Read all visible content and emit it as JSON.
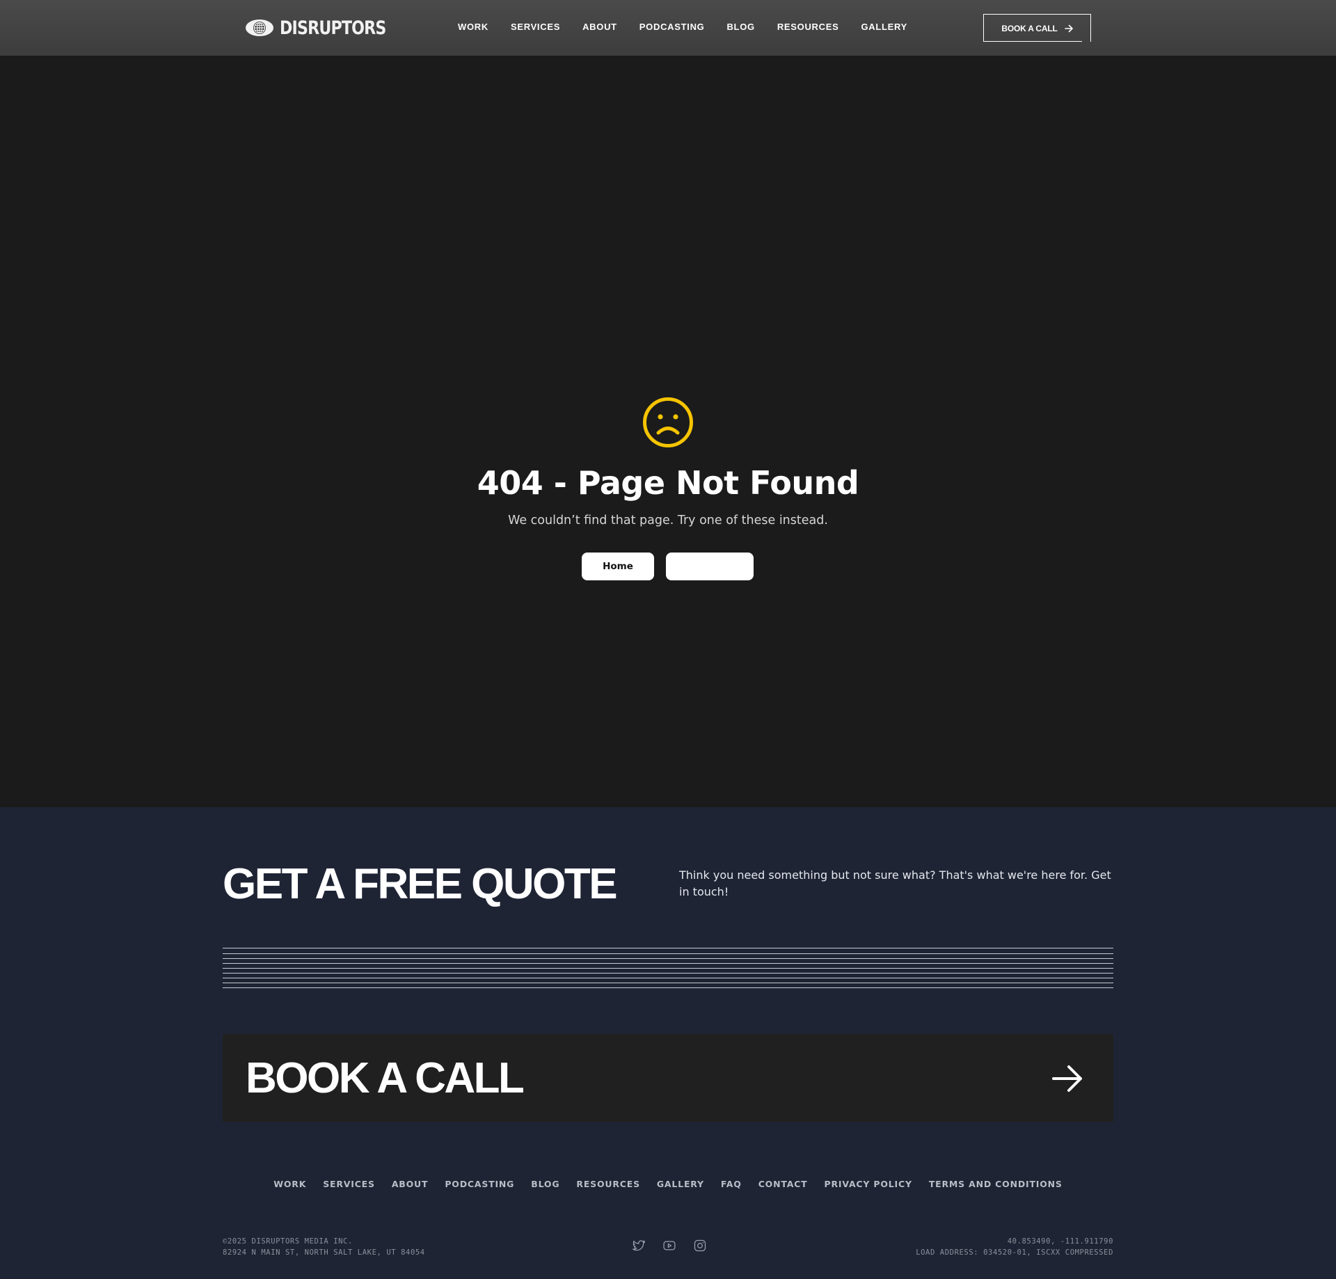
{
  "header": {
    "logo_text": "DISRUPTORS",
    "nav": [
      "WORK",
      "SERVICES",
      "ABOUT",
      "PODCASTING",
      "BLOG",
      "RESOURCES",
      "GALLERY"
    ],
    "cta_label": "BOOK A CALL",
    "cta_icon": "arrow-right-icon"
  },
  "error": {
    "icon": "sad-face-icon",
    "icon_color": "#f5c400",
    "title": "404 - Page Not Found",
    "message": "We couldn’t find that page. Try one of these instead.",
    "home_label": "Home",
    "second_label": ""
  },
  "footer": {
    "quote_title": "GET A FREE QUOTE",
    "quote_text": "Think you need something but not sure what? That's what we're here for. Get in touch!",
    "book_label": "BOOK A CALL",
    "book_icon": "arrow-right-icon",
    "nav": [
      "WORK",
      "SERVICES",
      "ABOUT",
      "PODCASTING",
      "BLOG",
      "RESOURCES",
      "GALLERY",
      "FAQ",
      "CONTACT",
      "PRIVACY POLICY",
      "TERMS AND CONDITIONS"
    ],
    "copyright_line1": "©2025 DISRUPTORS MEDIA INC.",
    "copyright_line2": "82924 N MAIN ST, NORTH SALT LAKE, UT 84054",
    "social": [
      "twitter-icon",
      "youtube-icon",
      "instagram-icon"
    ],
    "coords_line1": "40.853490, -111.911790",
    "coords_line2": "LOAD ADDRESS: 034520-01, ISCXX COMPRESSED"
  },
  "colors": {
    "header_bg": "#434343",
    "main_bg": "#1b1b1b",
    "footer_bg": "#1e2434",
    "accent": "#f5c400"
  }
}
